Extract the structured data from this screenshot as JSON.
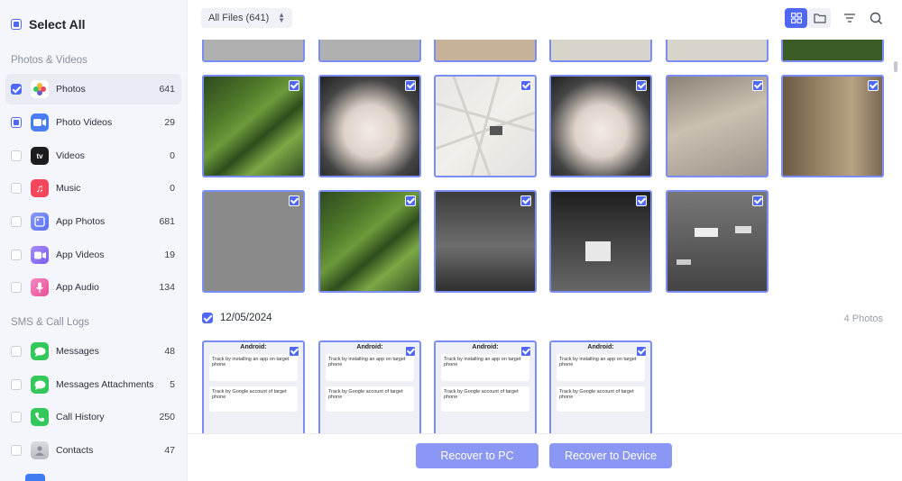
{
  "sidebar": {
    "select_all": "Select All",
    "sections": [
      {
        "title": "Photos & Videos",
        "items": [
          {
            "label": "Photos",
            "count": "641",
            "icon": "photos-icon",
            "color": "#f7a83a",
            "state": "checked",
            "active": true
          },
          {
            "label": "Photo Videos",
            "count": "29",
            "icon": "photo-videos-icon",
            "color": "#4a7df0",
            "state": "partial"
          },
          {
            "label": "Videos",
            "count": "0",
            "icon": "apple-tv-icon",
            "color": "#1c1c1e",
            "state": "unchecked"
          },
          {
            "label": "Music",
            "count": "0",
            "icon": "music-icon",
            "color": "#f5475c",
            "state": "unchecked"
          },
          {
            "label": "App Photos",
            "count": "681",
            "icon": "app-photos-icon",
            "color": "#6b7ff5",
            "state": "unchecked"
          },
          {
            "label": "App Videos",
            "count": "19",
            "icon": "app-videos-icon",
            "color": "#8a6df2",
            "state": "unchecked"
          },
          {
            "label": "App Audio",
            "count": "134",
            "icon": "microphone-icon",
            "color": "#ef5da8",
            "state": "unchecked"
          }
        ]
      },
      {
        "title": "SMS & Call Logs",
        "items": [
          {
            "label": "Messages",
            "count": "48",
            "icon": "messages-icon",
            "color": "#34c759",
            "state": "unchecked"
          },
          {
            "label": "Messages Attachments",
            "count": "5",
            "icon": "messages-attachments-icon",
            "color": "#34c759",
            "state": "unchecked"
          },
          {
            "label": "Call History",
            "count": "250",
            "icon": "phone-icon",
            "color": "#34c759",
            "state": "unchecked"
          },
          {
            "label": "Contacts",
            "count": "47",
            "icon": "contacts-icon",
            "color": "#c5c7cc",
            "state": "unchecked"
          }
        ]
      }
    ]
  },
  "topbar": {
    "file_filter": "All Files (641)",
    "tools": [
      "grid-view-icon",
      "folder-view-icon",
      "filter-icon",
      "search-icon"
    ]
  },
  "gallery": {
    "group_date": "12/05/2024",
    "group_count": "4 Photos",
    "doc_title": "Android:",
    "doc_line1": "Track by installing an app on target phone",
    "doc_line2": "Track by Google account of target phone"
  },
  "actions": {
    "recover_pc": "Recover to PC",
    "recover_device": "Recover to Device"
  },
  "colors": {
    "accent": "#4f68f6",
    "button": "#8b97f4",
    "sidebar_bg": "#f4f6fb",
    "tile_border": "#7b8cf4"
  }
}
